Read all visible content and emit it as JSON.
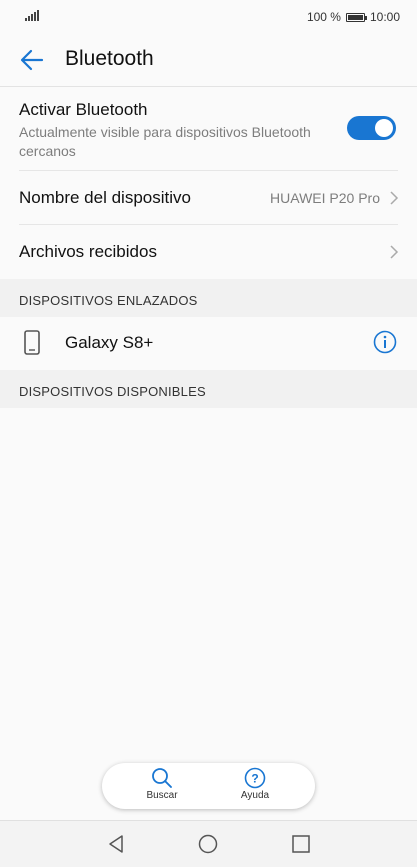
{
  "status_bar": {
    "battery_percent": "100 %",
    "time": "10:00",
    "battery_level": 1.0
  },
  "header": {
    "title": "Bluetooth",
    "back_icon": "arrow-left-icon"
  },
  "bluetooth": {
    "toggle_label": "Activar Bluetooth",
    "toggle_subtitle": "Actualmente visible para dispositivos Bluetooth cercanos",
    "enabled": true
  },
  "settings": {
    "device_name_label": "Nombre del dispositivo",
    "device_name_value": "HUAWEI P20 Pro",
    "received_files_label": "Archivos recibidos"
  },
  "paired": {
    "header": "DISPOSITIVOS ENLAZADOS",
    "devices": [
      {
        "name": "Galaxy S8+",
        "icon": "phone-icon"
      }
    ]
  },
  "available": {
    "header": "DISPOSITIVOS DISPONIBLES"
  },
  "bottom_actions": {
    "search_label": "Buscar",
    "help_label": "Ayuda"
  },
  "colors": {
    "accent": "#1976d2",
    "section_bg": "#f1f1f1",
    "background": "#fafafa"
  }
}
